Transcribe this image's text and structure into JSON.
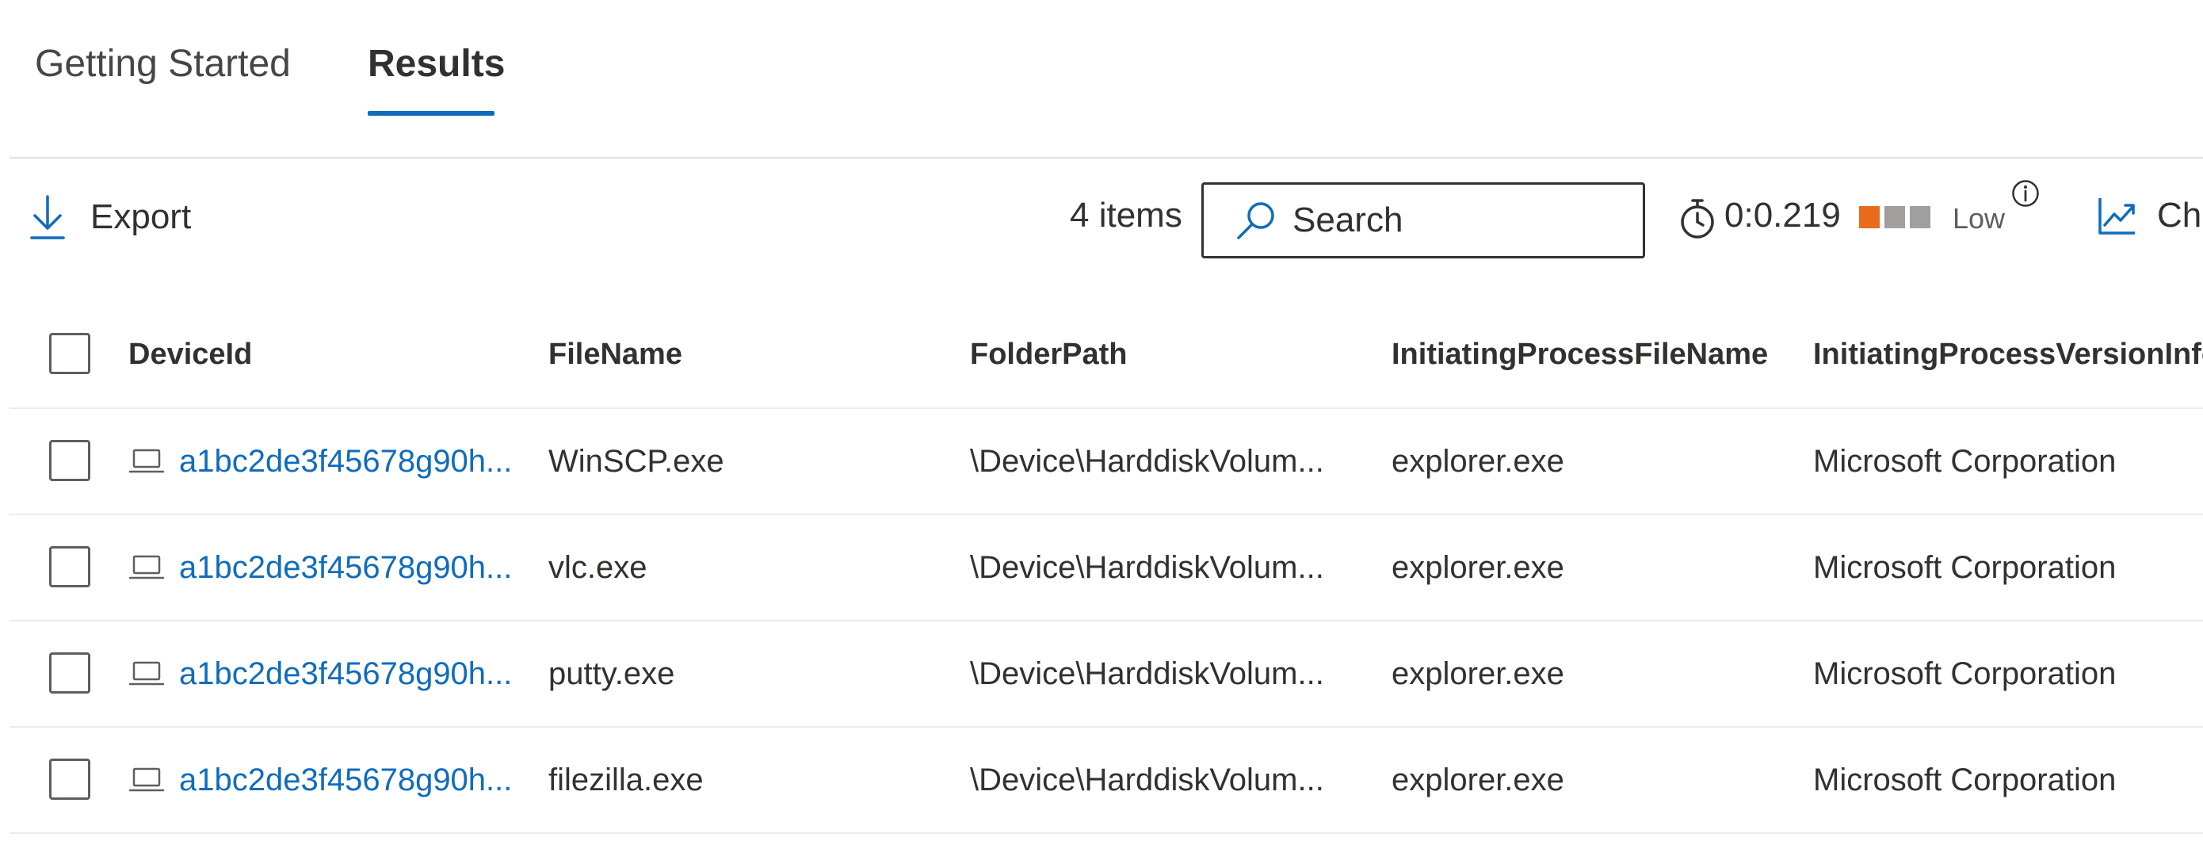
{
  "tabs": [
    {
      "label": "Getting Started",
      "active": false
    },
    {
      "label": "Results",
      "active": true
    }
  ],
  "toolbar": {
    "export_label": "Export",
    "items_count": "4 items",
    "search_placeholder": "Search",
    "search_value": "",
    "elapsed_time": "0:0.219",
    "resource_usage": {
      "level": "Low",
      "filled_bars": 1,
      "total_bars": 3
    },
    "chart_label": "Ch"
  },
  "table": {
    "columns": [
      "DeviceId",
      "FileName",
      "FolderPath",
      "InitiatingProcessFileName",
      "InitiatingProcessVersionInfo"
    ],
    "rows": [
      {
        "device_id": "a1bc2de3f45678g90h...",
        "file_name": "WinSCP.exe",
        "folder_path": "\\Device\\HarddiskVolum...",
        "initiating_process": "explorer.exe",
        "version_info": "Microsoft Corporation"
      },
      {
        "device_id": "a1bc2de3f45678g90h...",
        "file_name": "vlc.exe",
        "folder_path": "\\Device\\HarddiskVolum...",
        "initiating_process": "explorer.exe",
        "version_info": "Microsoft Corporation"
      },
      {
        "device_id": "a1bc2de3f45678g90h...",
        "file_name": "putty.exe",
        "folder_path": "\\Device\\HarddiskVolum...",
        "initiating_process": "explorer.exe",
        "version_info": "Microsoft Corporation"
      },
      {
        "device_id": "a1bc2de3f45678g90h...",
        "file_name": "filezilla.exe",
        "folder_path": "\\Device\\HarddiskVolum...",
        "initiating_process": "explorer.exe",
        "version_info": "Microsoft Corporation"
      }
    ]
  },
  "colors": {
    "accent": "#0f6cbd",
    "usage_on": "#ea6a1c",
    "usage_off": "#a19f9d",
    "text": "#323130"
  },
  "icons": {
    "export": "download-arrow-icon",
    "search": "search-icon",
    "timer": "stopwatch-icon",
    "info": "info-icon",
    "chart": "line-chart-icon",
    "device": "laptop-icon"
  }
}
